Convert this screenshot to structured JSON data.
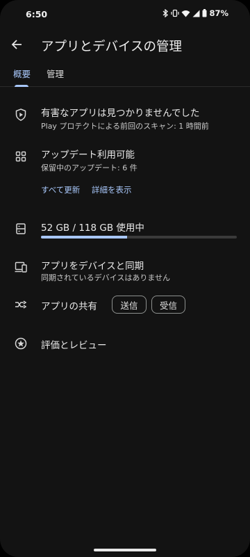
{
  "status_bar": {
    "time": "6:50",
    "battery": "87%"
  },
  "header": {
    "title": "アプリとデバイスの管理"
  },
  "tabs": [
    {
      "label": "概要"
    },
    {
      "label": "管理"
    }
  ],
  "protect": {
    "title": "有害なアプリは見つかりませんでした",
    "subtitle": "Play プロテクトによる前回のスキャン: 1 時間前"
  },
  "updates": {
    "title": "アップデート利用可能",
    "subtitle": "保留中のアップデート: 6 件",
    "update_all": "すべて更新",
    "details": "詳細を表示"
  },
  "storage": {
    "label": "52 GB / 118 GB 使用中",
    "used_fraction": 0.44
  },
  "sync": {
    "title": "アプリをデバイスと同期",
    "subtitle": "同期されているデバイスはありません"
  },
  "share": {
    "title": "アプリの共有",
    "send": "送信",
    "receive": "受信"
  },
  "ratings": {
    "title": "評価とレビュー"
  },
  "colors": {
    "background": "#131313",
    "accent": "#a8c7fa",
    "text": "#e9e9e9"
  }
}
